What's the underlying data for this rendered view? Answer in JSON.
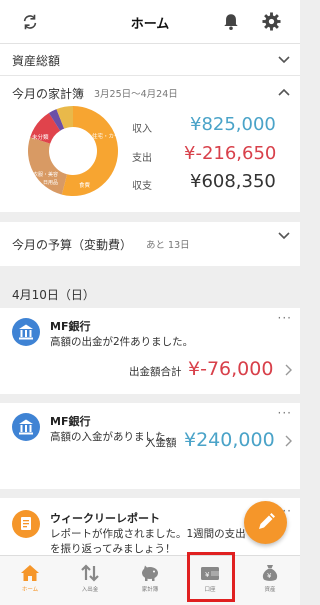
{
  "header": {
    "title": "ホーム",
    "left_icon": "sync-icon",
    "right_icons": [
      "bell-icon",
      "gear-icon"
    ]
  },
  "assets": {
    "label": "資産総額"
  },
  "household": {
    "title": "今月の家計簿",
    "range": "3月25日〜4月24日",
    "donut": {
      "segments": [
        {
          "label": "未分類",
          "percent": 54,
          "color": "#f7a531"
        },
        {
          "label": "住宅・カー",
          "percent": 26,
          "color": "#d89a64"
        },
        {
          "label": "食費",
          "percent": 11,
          "color": "#e0434c"
        },
        {
          "label": "",
          "percent": 3,
          "color": "#6b4fa7"
        },
        {
          "label": "衣服・美容",
          "percent": 6,
          "color": "#e9b94a"
        }
      ],
      "extra_label": "日用品"
    },
    "rows": [
      {
        "label": "収入",
        "value": "¥825,000",
        "color": "#4aa3c8"
      },
      {
        "label": "支出",
        "value": "¥-216,650",
        "color": "#d8404a"
      },
      {
        "label": "収支",
        "value": "¥608,350",
        "color": "#333333"
      }
    ]
  },
  "budget": {
    "title": "今月の予算（変動費）",
    "remaining": "あと 13日"
  },
  "date_header": "4月10日（日）",
  "cards": [
    {
      "title": "MF銀行",
      "message": "高額の出金が2件ありました。",
      "amount_label": "出金額合計",
      "amount": "¥-76,000"
    },
    {
      "title": "MF銀行",
      "message": "高額の入金がありました。",
      "amount_label": "入金額",
      "amount": "¥240,000"
    },
    {
      "title": "ウィークリーレポート",
      "message_line1": "レポートが作成されました。1週間の支出",
      "message_line2": "を振り返ってみましょう！"
    }
  ],
  "card_menu": "···",
  "tabs": [
    {
      "label": "ホーム",
      "icon": "home-icon",
      "active": true
    },
    {
      "label": "入出金",
      "icon": "transfer-icon",
      "active": false
    },
    {
      "label": "家計簿",
      "icon": "piggy-bank-icon",
      "active": false
    },
    {
      "label": "口座",
      "icon": "wallet-icon",
      "active": false
    },
    {
      "label": "資産",
      "icon": "money-bag-icon",
      "active": false
    }
  ],
  "colors": {
    "accent": "#f5962a",
    "blue": "#4aa3c8",
    "red": "#d8404a",
    "highlight": "#e02020"
  }
}
